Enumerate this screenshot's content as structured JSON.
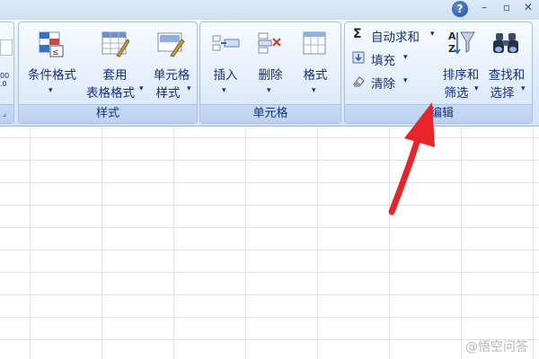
{
  "window": {
    "help": "?",
    "minimize": "–",
    "restore": "▫",
    "close": "✕"
  },
  "ribbon": {
    "left_group": {
      "number_label": "00\n.0"
    },
    "styles": {
      "label": "样式",
      "conditional_formatting": "条件格式",
      "table_format_line1": "套用",
      "table_format_line2": "表格格式",
      "cell_styles_line1": "单元格",
      "cell_styles_line2": "样式"
    },
    "cells": {
      "label": "单元格",
      "insert": "插入",
      "delete": "删除",
      "format": "格式"
    },
    "editing": {
      "label": "编辑",
      "autosum": "自动求和",
      "fill": "填充",
      "clear": "清除",
      "sort_filter_line1": "排序和",
      "sort_filter_line2": "筛选",
      "find_select_line1": "查找和",
      "find_select_line2": "选择"
    }
  },
  "watermark": "@悟空问答",
  "colors": {
    "ribbon_text": "#15317e",
    "arrow": "#e8242b"
  }
}
